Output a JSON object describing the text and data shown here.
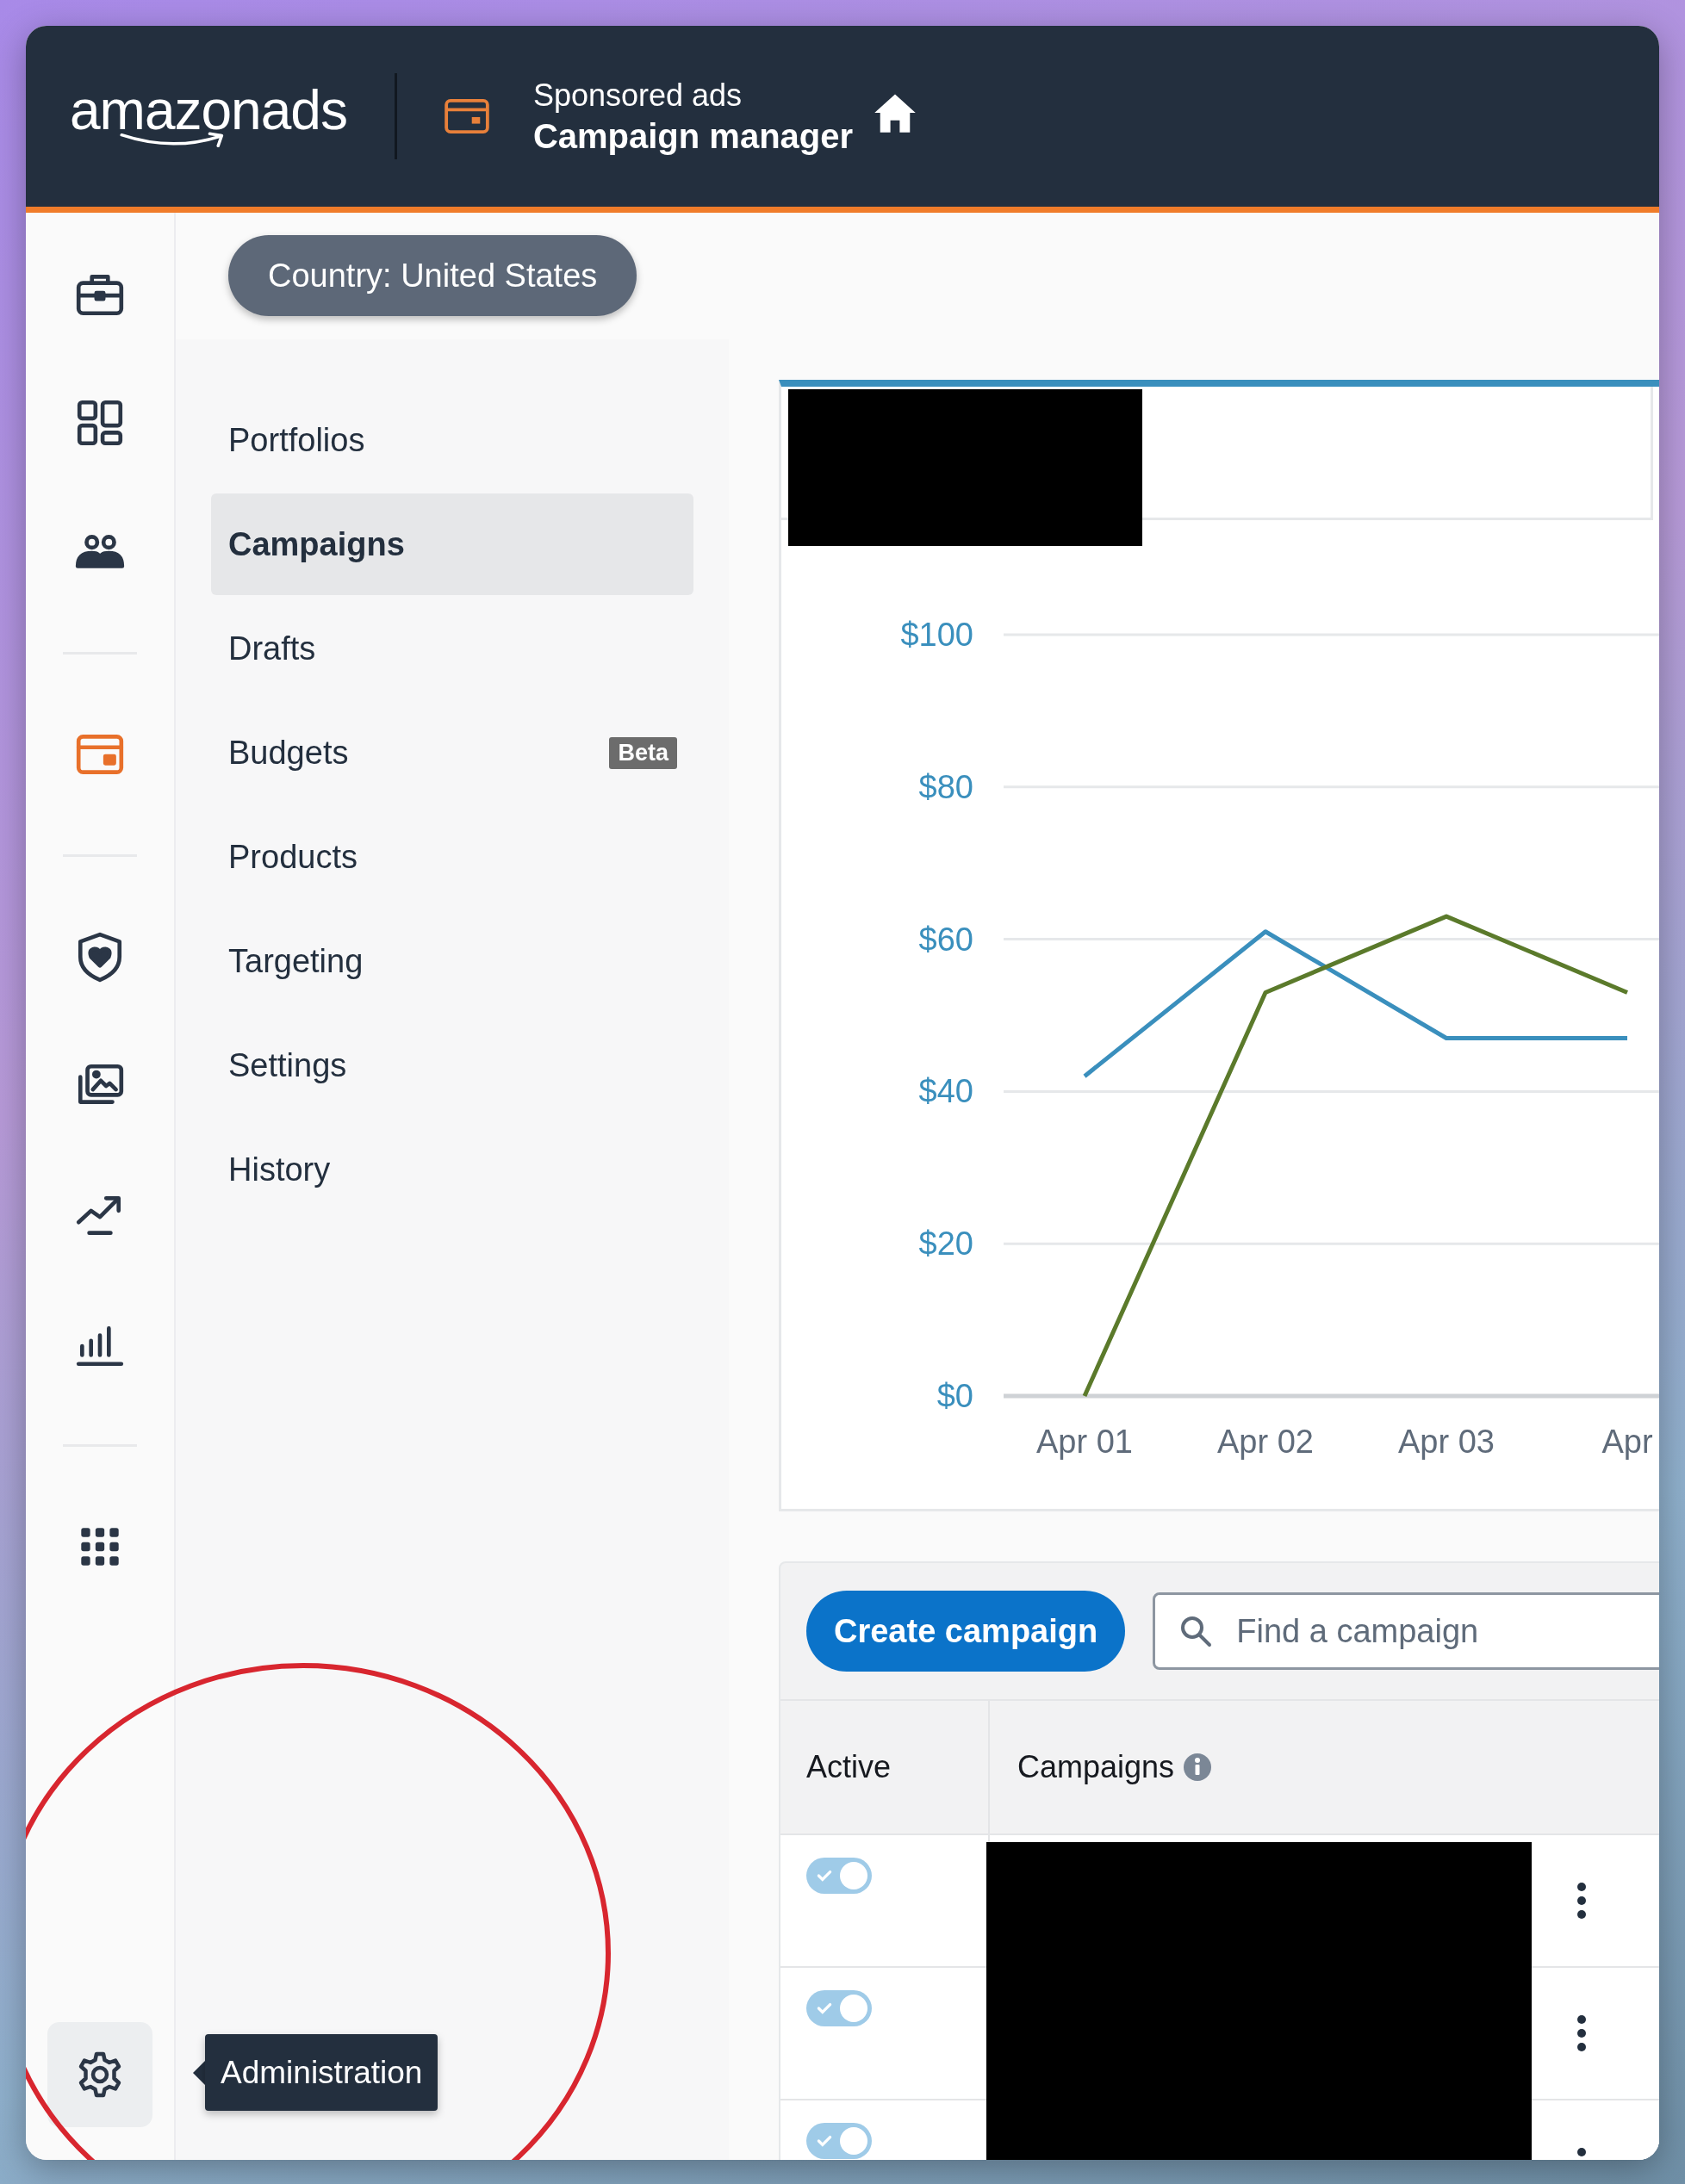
{
  "header": {
    "logo": "amazonads",
    "product_subtitle": "Sponsored ads",
    "product_title": "Campaign manager"
  },
  "rail": {
    "items": [
      {
        "selected": false
      },
      {
        "selected": false
      },
      {
        "selected": false
      },
      {
        "selected": true
      },
      {
        "selected": false
      },
      {
        "selected": false
      },
      {
        "selected": false
      },
      {
        "selected": false
      },
      {
        "selected": false
      }
    ],
    "tooltip": "Administration"
  },
  "country_filter": "Country: United States",
  "nav": [
    {
      "label": "Portfolios",
      "selected": false
    },
    {
      "label": "Campaigns",
      "selected": true
    },
    {
      "label": "Drafts",
      "selected": false
    },
    {
      "label": "Budgets",
      "selected": false,
      "badge": "Beta"
    },
    {
      "label": "Products",
      "selected": false
    },
    {
      "label": "Targeting",
      "selected": false
    },
    {
      "label": "Settings",
      "selected": false
    },
    {
      "label": "History",
      "selected": false
    }
  ],
  "chart": {
    "chart_data": {
      "type": "line",
      "categories": [
        "Apr 01",
        "Apr 02",
        "Apr 03",
        "Apr"
      ],
      "grid": true,
      "series": [
        {
          "color": "#3a8fbd",
          "values": [
            42,
            61,
            47,
            47
          ]
        },
        {
          "color": "#5b7a2b",
          "values": [
            0,
            53,
            63,
            53
          ]
        }
      ],
      "ylim": [
        0,
        100
      ],
      "yticks": [
        {
          "value": 0,
          "label": "$0"
        },
        {
          "value": 20,
          "label": "$20"
        },
        {
          "value": 40,
          "label": "$40"
        },
        {
          "value": 60,
          "label": "$60"
        },
        {
          "value": 80,
          "label": "$80"
        },
        {
          "value": 100,
          "label": "$100"
        }
      ]
    }
  },
  "toolbar": {
    "create_button": "Create campaign",
    "search": {
      "placeholder": "Find a campaign"
    }
  },
  "table": {
    "columns": [
      "Active",
      "Campaigns"
    ],
    "rows": [
      {
        "active": true
      },
      {
        "active": true
      },
      {
        "active": true
      }
    ]
  }
}
